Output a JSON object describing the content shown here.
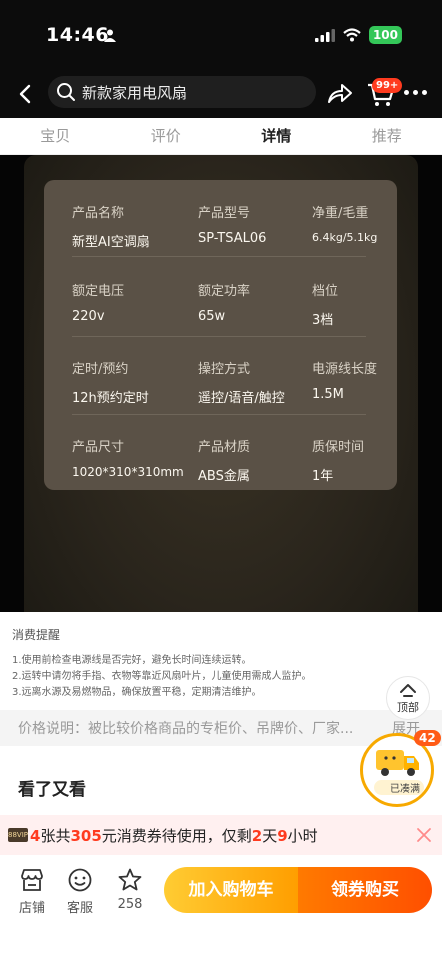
{
  "status_bar": {
    "time": "14:46",
    "battery": "100"
  },
  "header": {
    "search_text": "新款家用电风扇",
    "cart_badge": "99+"
  },
  "tabs": [
    {
      "label": "宝贝",
      "active": false
    },
    {
      "label": "评价",
      "active": false
    },
    {
      "label": "详情",
      "active": true
    },
    {
      "label": "推荐",
      "active": false
    }
  ],
  "specs": [
    [
      {
        "label": "产品名称",
        "value": "新型AI空调扇"
      },
      {
        "label": "产品型号",
        "value": "SP-TSAL06"
      },
      {
        "label": "净重/毛重",
        "value": "6.4kg/5.1kg"
      }
    ],
    [
      {
        "label": "额定电压",
        "value": "220v"
      },
      {
        "label": "额定功率",
        "value": "65w"
      },
      {
        "label": "档位",
        "value": "3档"
      }
    ],
    [
      {
        "label": "定时/预约",
        "value": "12h预约定时"
      },
      {
        "label": "操控方式",
        "value": "遥控/语音/触控"
      },
      {
        "label": "电源线长度",
        "value": "1.5M"
      }
    ],
    [
      {
        "label": "产品尺寸",
        "value": "1020*310*310mm"
      },
      {
        "label": "产品材质",
        "value": "ABS金属"
      },
      {
        "label": "质保时间",
        "value": "1年"
      }
    ]
  ],
  "notice": {
    "title": "消费提醒",
    "lines": [
      "1.使用前检查电源线是否完好，避免长时间连续运转。",
      "2.运转中请勿将手指、衣物等靠近风扇叶片，儿童使用需成人监护。",
      "3.远离水源及易燃物品，确保放置平稳，定期清洁维护。"
    ]
  },
  "top_button_label": "顶部",
  "price_note": {
    "text": "价格说明：被比较价格商品的专柜价、吊牌价、厂家...",
    "more": "展开"
  },
  "badge": {
    "count": "42",
    "label": "已凑满"
  },
  "look_again_title": "看了又看",
  "coupon": {
    "icon_text": "88VIP",
    "count": "4",
    "text_a": "张共",
    "amount": "305",
    "text_b": "元消费券待使用，仅剩",
    "days": "2",
    "text_c": "天",
    "hours": "9",
    "text_d": "小时"
  },
  "bottom_bar": {
    "store_label": "店铺",
    "service_label": "客服",
    "favorite_count": "258",
    "add_cart_label": "加入购物车",
    "buy_label": "领券购买"
  }
}
